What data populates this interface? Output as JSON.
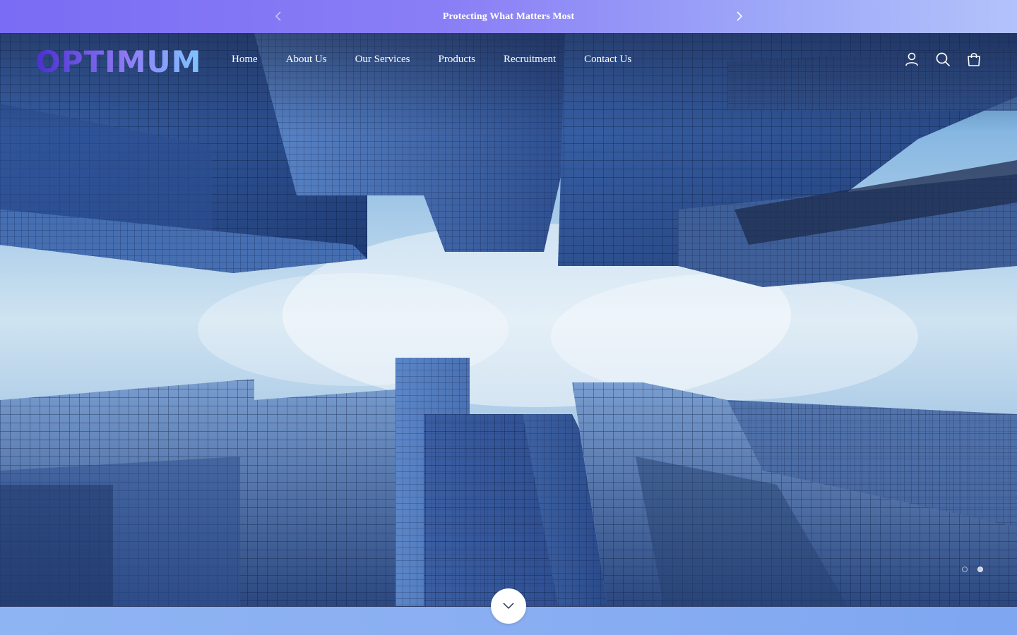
{
  "announcement": {
    "message": "Protecting What Matters Most",
    "prev_icon": "chevron-left-icon",
    "next_icon": "chevron-right-icon"
  },
  "header": {
    "logo_text": "OPTIMUM",
    "nav": [
      {
        "label": "Home"
      },
      {
        "label": "About Us"
      },
      {
        "label": "Our Services"
      },
      {
        "label": "Products"
      },
      {
        "label": "Recruitment"
      },
      {
        "label": "Contact Us"
      }
    ],
    "icons": [
      "account-icon",
      "search-icon",
      "cart-bag-icon"
    ]
  },
  "hero": {
    "slides_total": 2,
    "active_slide": 2,
    "scroll_icon": "chevron-down-icon"
  },
  "colors": {
    "announce_start": "#7a6cf4",
    "announce_end": "#b3c2fb",
    "logo_gradient_start": "#4b2fd0",
    "logo_gradient_end": "#7fc6ff",
    "bottom_strip": "#8aaef2"
  }
}
